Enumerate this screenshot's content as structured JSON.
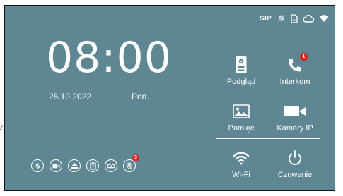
{
  "status": {
    "sip_label": "SIP",
    "icons": [
      "mute-bell-icon",
      "sd-card-icon",
      "cloud-icon",
      "wifi-icon"
    ]
  },
  "clock": {
    "time": "08:00",
    "date": "25.10.2022",
    "weekday": "Pon."
  },
  "bottom_bar": {
    "buttons": [
      "do-not-disturb-icon",
      "camera-icon",
      "eject-icon",
      "door-lock-icon",
      "voicemail-icon",
      "settings-icon"
    ],
    "settings_badge": "3"
  },
  "menu": {
    "tiles": [
      {
        "label": "Podgląd",
        "icon": "intercom-panel-icon"
      },
      {
        "label": "Interkom",
        "icon": "phone-icon",
        "badge": "1"
      },
      {
        "label": "Pamięć",
        "icon": "gallery-icon"
      },
      {
        "label": "Kamery IP",
        "icon": "video-camera-icon"
      },
      {
        "label": "Wi-Fi",
        "icon": "wifi-icon"
      },
      {
        "label": "Czuwanie",
        "icon": "power-icon"
      }
    ]
  },
  "colors": {
    "background": "#5f8793",
    "badge": "#e0201c",
    "foreground": "#ffffff"
  }
}
